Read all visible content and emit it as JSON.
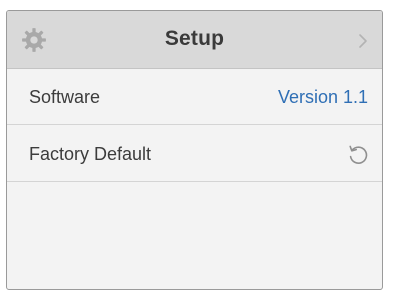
{
  "header": {
    "title": "Setup",
    "left_icon": "gear-icon",
    "right_icon": "chevron-right-icon"
  },
  "rows": [
    {
      "label": "Software",
      "value": "Version 1.1"
    },
    {
      "label": "Factory Default",
      "icon": "reset-icon"
    }
  ],
  "colors": {
    "header_bg": "#d9d9d9",
    "panel_bg": "#f3f3f3",
    "value_text": "#2f6fb5",
    "label_text": "#3c3c3c"
  }
}
